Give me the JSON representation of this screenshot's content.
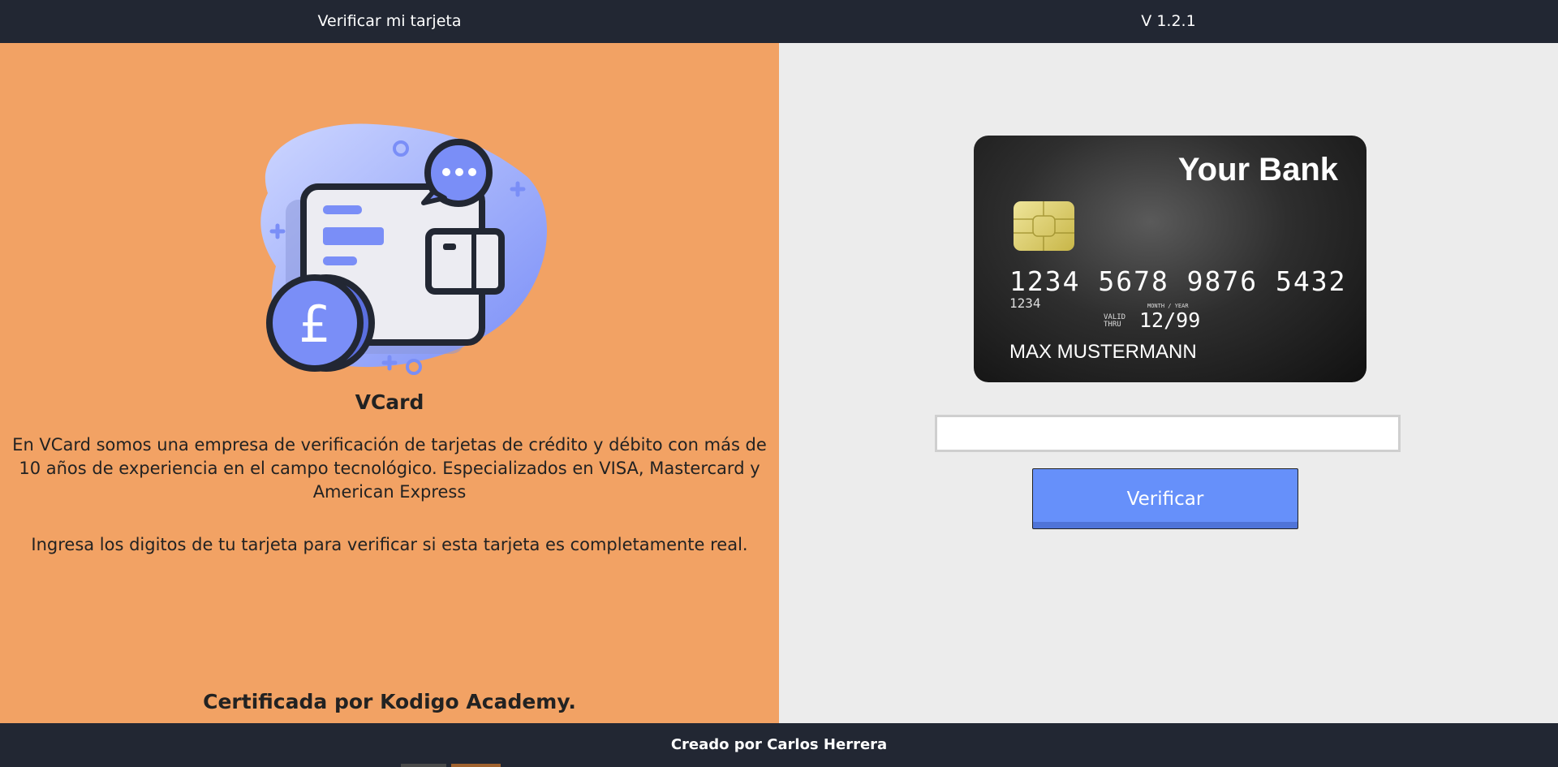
{
  "header": {
    "title": "Verificar mi tarjeta",
    "version": "V 1.2.1"
  },
  "info": {
    "brand": "VCard",
    "description": "En VCard somos una empresa de verificación de tarjetas de crédito y débito con más de 10 años de experiencia en el campo tecnológico. Especializados en VISA, Mastercard y American Express",
    "prompt": "Ingresa los digitos de tu tarjeta para verificar si esta tarjeta es completamente real.",
    "certification": "Certificada por Kodigo Academy.",
    "illustration_icon": "wallet-pound-coin-icon",
    "illustration_symbol": "£"
  },
  "card": {
    "bank_name": "Your Bank",
    "number": "1234 5678 9876 5432",
    "short_number": "1234",
    "valid_label_1": "VALID",
    "valid_label_2": "THRU",
    "month_year_label": "MONTH / YEAR",
    "expiry": "12/99",
    "holder": "MAX MUSTERMANN"
  },
  "form": {
    "input_value": "",
    "button_label": "Verificar"
  },
  "footer": {
    "credit": "Creado por Carlos Herrera"
  },
  "colors": {
    "header_bg": "#222733",
    "left_panel_bg": "#f2a264",
    "right_panel_bg": "#ececec",
    "button_bg": "#6690fa",
    "illustration_accent": "#7a8ef7"
  }
}
